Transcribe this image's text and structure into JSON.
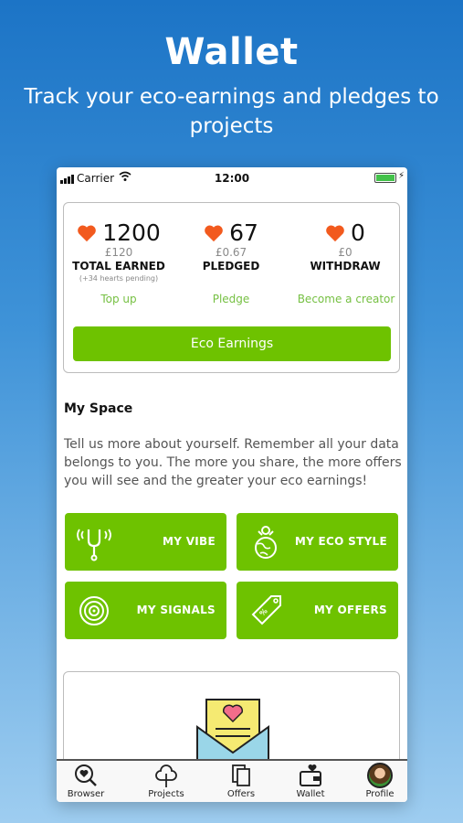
{
  "hero": {
    "title": "Wallet",
    "subtitle": "Track your eco-earnings and pledges to projects"
  },
  "status_bar": {
    "carrier": "Carrier",
    "time": "12:00",
    "battery_level": 1.0
  },
  "summary": {
    "stats": [
      {
        "value": "1200",
        "money": "£120",
        "label": "TOTAL EARNED",
        "note": "(+34 hearts pending)",
        "link": "Top up"
      },
      {
        "value": "67",
        "money": "£0.67",
        "label": "PLEDGED",
        "note": "",
        "link": "Pledge"
      },
      {
        "value": "0",
        "money": "£0",
        "label": "WITHDRAW",
        "note": "",
        "link": "Become a creator"
      }
    ],
    "eco_button": "Eco Earnings"
  },
  "my_space": {
    "title": "My Space",
    "text": "Tell us more about yourself. Remember all your data belongs to you. The more you share, the more offers you will see and the greater your eco earnings!",
    "tiles": [
      {
        "label": "MY VIBE",
        "icon": "tuning-fork-icon"
      },
      {
        "label": "MY ECO STYLE",
        "icon": "globe-person-icon"
      },
      {
        "label": "MY SIGNALS",
        "icon": "signal-rings-icon"
      },
      {
        "label": "MY OFFERS",
        "icon": "tag-icon"
      }
    ]
  },
  "tabbar": {
    "items": [
      {
        "label": "Browser",
        "icon": "heart-search-icon"
      },
      {
        "label": "Projects",
        "icon": "tree-icon"
      },
      {
        "label": "Offers",
        "icon": "documents-icon"
      },
      {
        "label": "Wallet",
        "icon": "wallet-heart-icon"
      },
      {
        "label": "Profile",
        "icon": "avatar"
      }
    ]
  },
  "colors": {
    "accent_green": "#6ec200",
    "link_green": "#76c043",
    "heart_orange": "#f25a1e",
    "hero_blue": "#1c74c6"
  }
}
